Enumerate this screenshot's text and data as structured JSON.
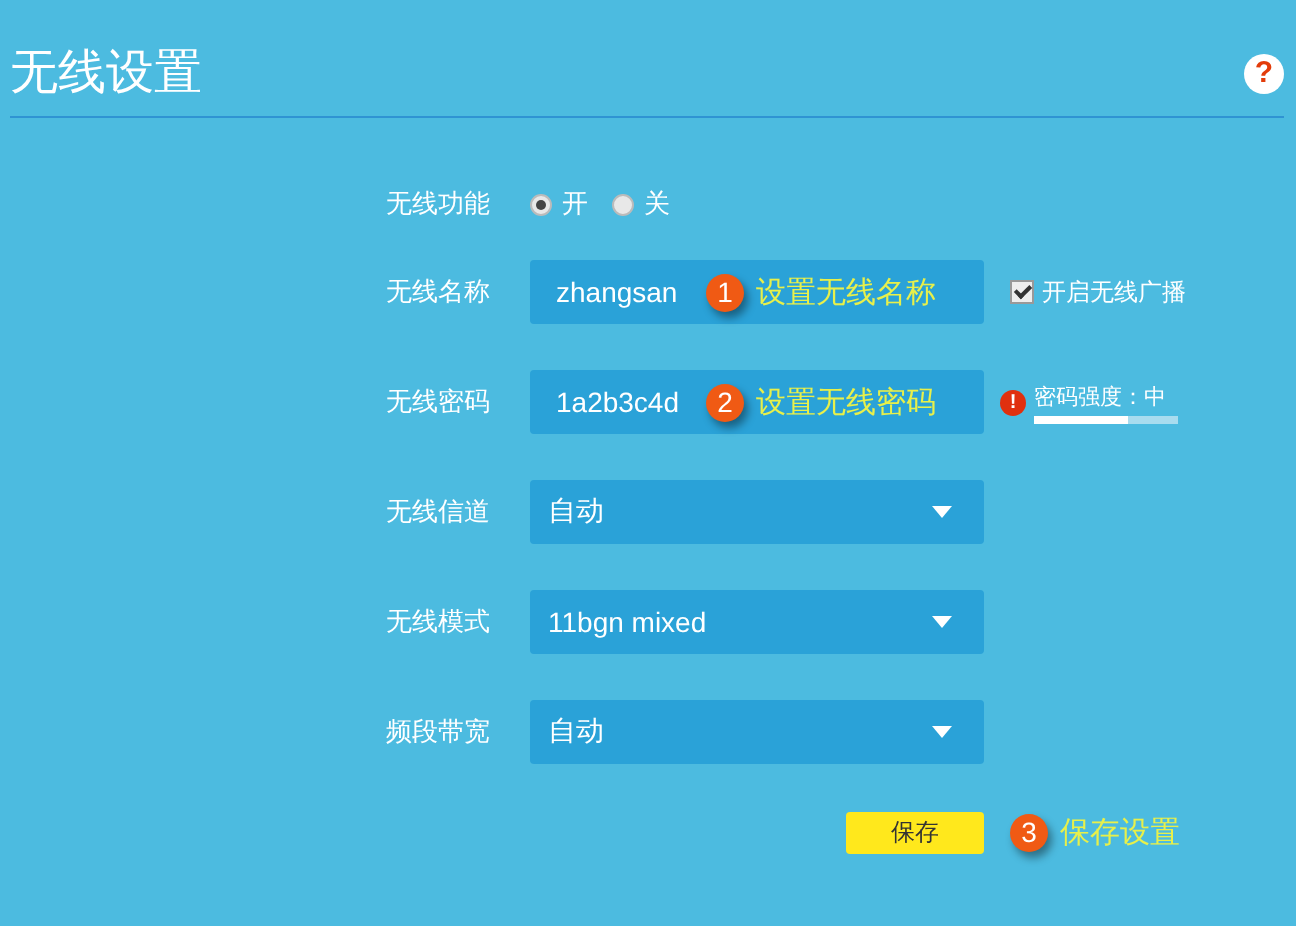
{
  "page": {
    "title": "无线设置",
    "help": "?"
  },
  "form": {
    "power": {
      "label": "无线功能",
      "options": [
        {
          "label": "开",
          "selected": true
        },
        {
          "label": "关",
          "selected": false
        }
      ]
    },
    "ssid": {
      "label": "无线名称",
      "value": "zhangsan",
      "callout": {
        "number": "1",
        "text": "设置无线名称"
      },
      "broadcast": {
        "label": "开启无线广播",
        "checked": true
      }
    },
    "password": {
      "label": "无线密码",
      "value": "1a2b3c4d",
      "callout": {
        "number": "2",
        "text": "设置无线密码"
      },
      "warning": "!",
      "strength": {
        "label": "密码强度：中",
        "level": 0.65
      }
    },
    "selects": [
      {
        "label": "无线信道",
        "value": "自动"
      },
      {
        "label": "无线模式",
        "value": "11bgn mixed"
      },
      {
        "label": "频段带宽",
        "value": "自动"
      }
    ],
    "save": {
      "label": "保存",
      "callout": {
        "number": "3",
        "text": "保存设置"
      }
    }
  }
}
